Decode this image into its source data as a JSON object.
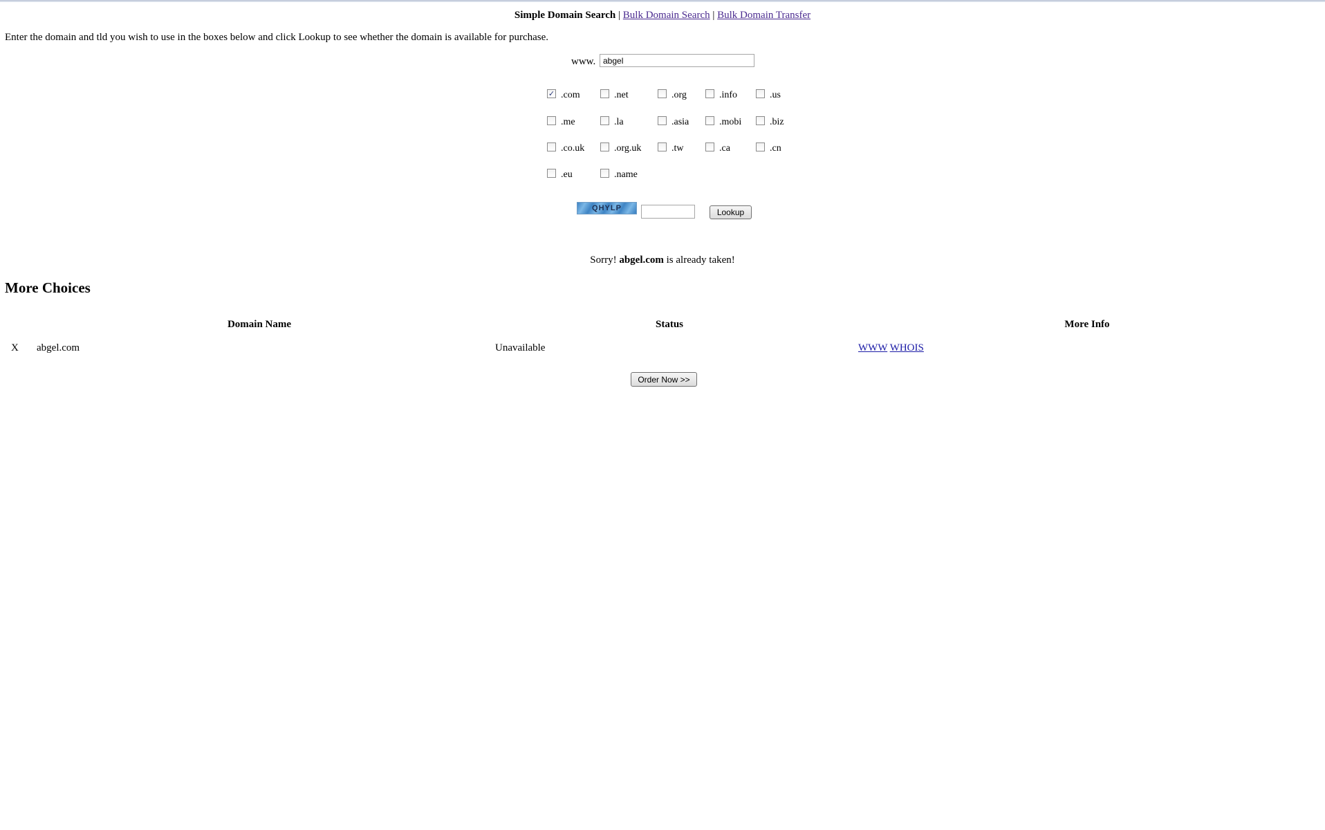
{
  "nav": {
    "simple_search": "Simple Domain Search",
    "separator": "|",
    "bulk_search": "Bulk Domain Search",
    "bulk_transfer": "Bulk Domain Transfer"
  },
  "intro_text": "Enter the domain and tld you wish to use in the boxes below and click Lookup to see whether the domain is available for purchase.",
  "search": {
    "prefix": "www.",
    "value": "abgel"
  },
  "tlds": [
    {
      "label": ".com",
      "checked": true
    },
    {
      "label": ".net",
      "checked": false
    },
    {
      "label": ".org",
      "checked": false
    },
    {
      "label": ".info",
      "checked": false
    },
    {
      "label": ".us",
      "checked": false
    },
    {
      "label": ".me",
      "checked": false
    },
    {
      "label": ".la",
      "checked": false
    },
    {
      "label": ".asia",
      "checked": false
    },
    {
      "label": ".mobi",
      "checked": false
    },
    {
      "label": ".biz",
      "checked": false
    },
    {
      "label": ".co.uk",
      "checked": false
    },
    {
      "label": ".org.uk",
      "checked": false
    },
    {
      "label": ".tw",
      "checked": false
    },
    {
      "label": ".ca",
      "checked": false
    },
    {
      "label": ".cn",
      "checked": false
    },
    {
      "label": ".eu",
      "checked": false
    },
    {
      "label": ".name",
      "checked": false
    }
  ],
  "captcha": {
    "code": "QHYLP",
    "value": ""
  },
  "lookup_label": "Lookup",
  "result": {
    "prefix": "Sorry! ",
    "domain": "abgel.com",
    "suffix": " is already taken!"
  },
  "more_choices": {
    "heading": "More Choices",
    "columns": [
      "Domain Name",
      "Status",
      "More Info"
    ],
    "rows": [
      {
        "marker": "X",
        "domain": "abgel.com",
        "status": "Unavailable",
        "links": [
          "WWW",
          "WHOIS"
        ]
      }
    ]
  },
  "order_label": "Order Now >>",
  "colors": {
    "link": "#1a1aa6",
    "visited_link": "#4a2a8f",
    "checkmark": "#2b3a7a"
  }
}
